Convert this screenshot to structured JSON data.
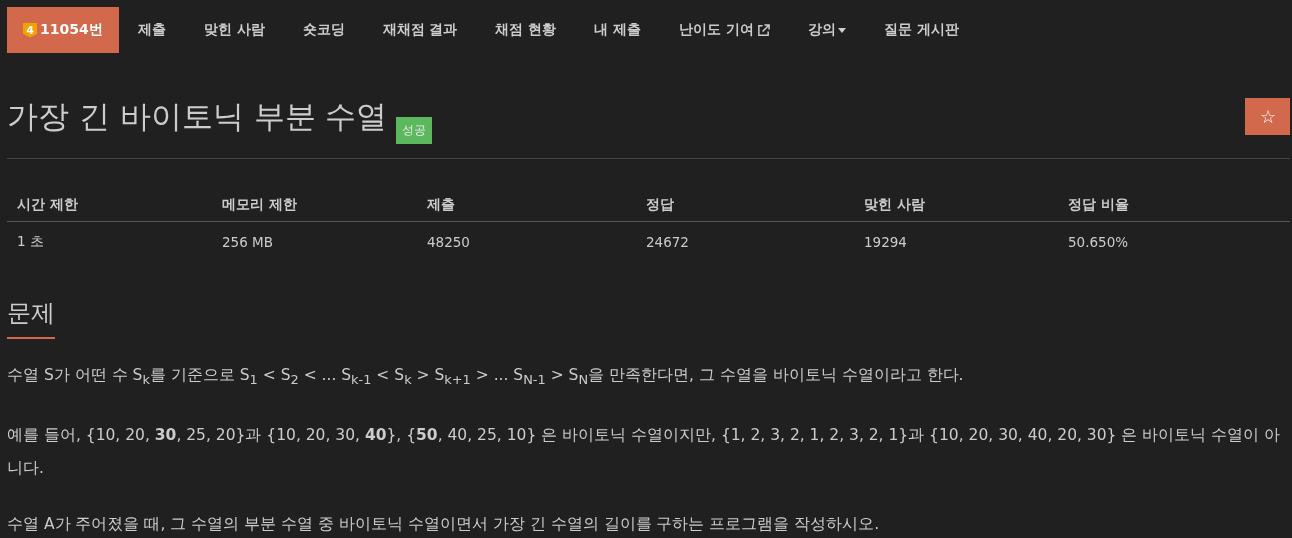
{
  "nav": [
    {
      "label": "11054번",
      "tier": "4",
      "selected": true,
      "kind": "plain"
    },
    {
      "label": "제출",
      "selected": false,
      "kind": "plain"
    },
    {
      "label": "맞힌 사람",
      "selected": false,
      "kind": "plain"
    },
    {
      "label": "숏코딩",
      "selected": false,
      "kind": "plain"
    },
    {
      "label": "재채점 결과",
      "selected": false,
      "kind": "plain"
    },
    {
      "label": "채점 현황",
      "selected": false,
      "kind": "plain"
    },
    {
      "label": "내 제출",
      "selected": false,
      "kind": "plain"
    },
    {
      "label": "난이도 기여",
      "selected": false,
      "kind": "external"
    },
    {
      "label": "강의",
      "selected": false,
      "kind": "dropdown"
    },
    {
      "label": "질문 게시판",
      "selected": false,
      "kind": "plain"
    }
  ],
  "title": "가장 긴 바이토닉 부분 수열",
  "status_badge": "성공",
  "star_button": "☆",
  "info_table": {
    "columns": [
      "시간 제한",
      "메모리 제한",
      "제출",
      "정답",
      "맞힌 사람",
      "정답 비율"
    ],
    "rows": [
      [
        "1 초",
        "256 MB",
        "48250",
        "24672",
        "19294",
        "50.650%"
      ]
    ]
  },
  "section_title": "문제",
  "paragraphs": [
    "수열 S가 어떤 수 S$_{k}$를 기준으로 S$_{1}$ < S$_{2}$ < ... S$_{k-1}$ < S$_{k}$ > S$_{k+1}$ > ... S$_{N-1}$ > S$_{N}$을 만족한다면, 그 수열을 바이토닉 수열이라고 한다.",
    "예를 들어, {10, 20, **30**, 25, 20}과 {10, 20, 30, **40**}, {**50**, 40, 25, 10} 은 바이토닉 수열이지만,  {1, 2, 3, 2, 1, 2, 3, 2, 1}과 {10, 20, 30, 40, 20, 30} 은 바이토닉 수열이 아니다.",
    "수열 A가 주어졌을 때, 그 수열의 부분 수열 중 바이토닉 수열이면서 가장 긴 수열의 길이를 구하는 프로그램을 작성하시오."
  ]
}
